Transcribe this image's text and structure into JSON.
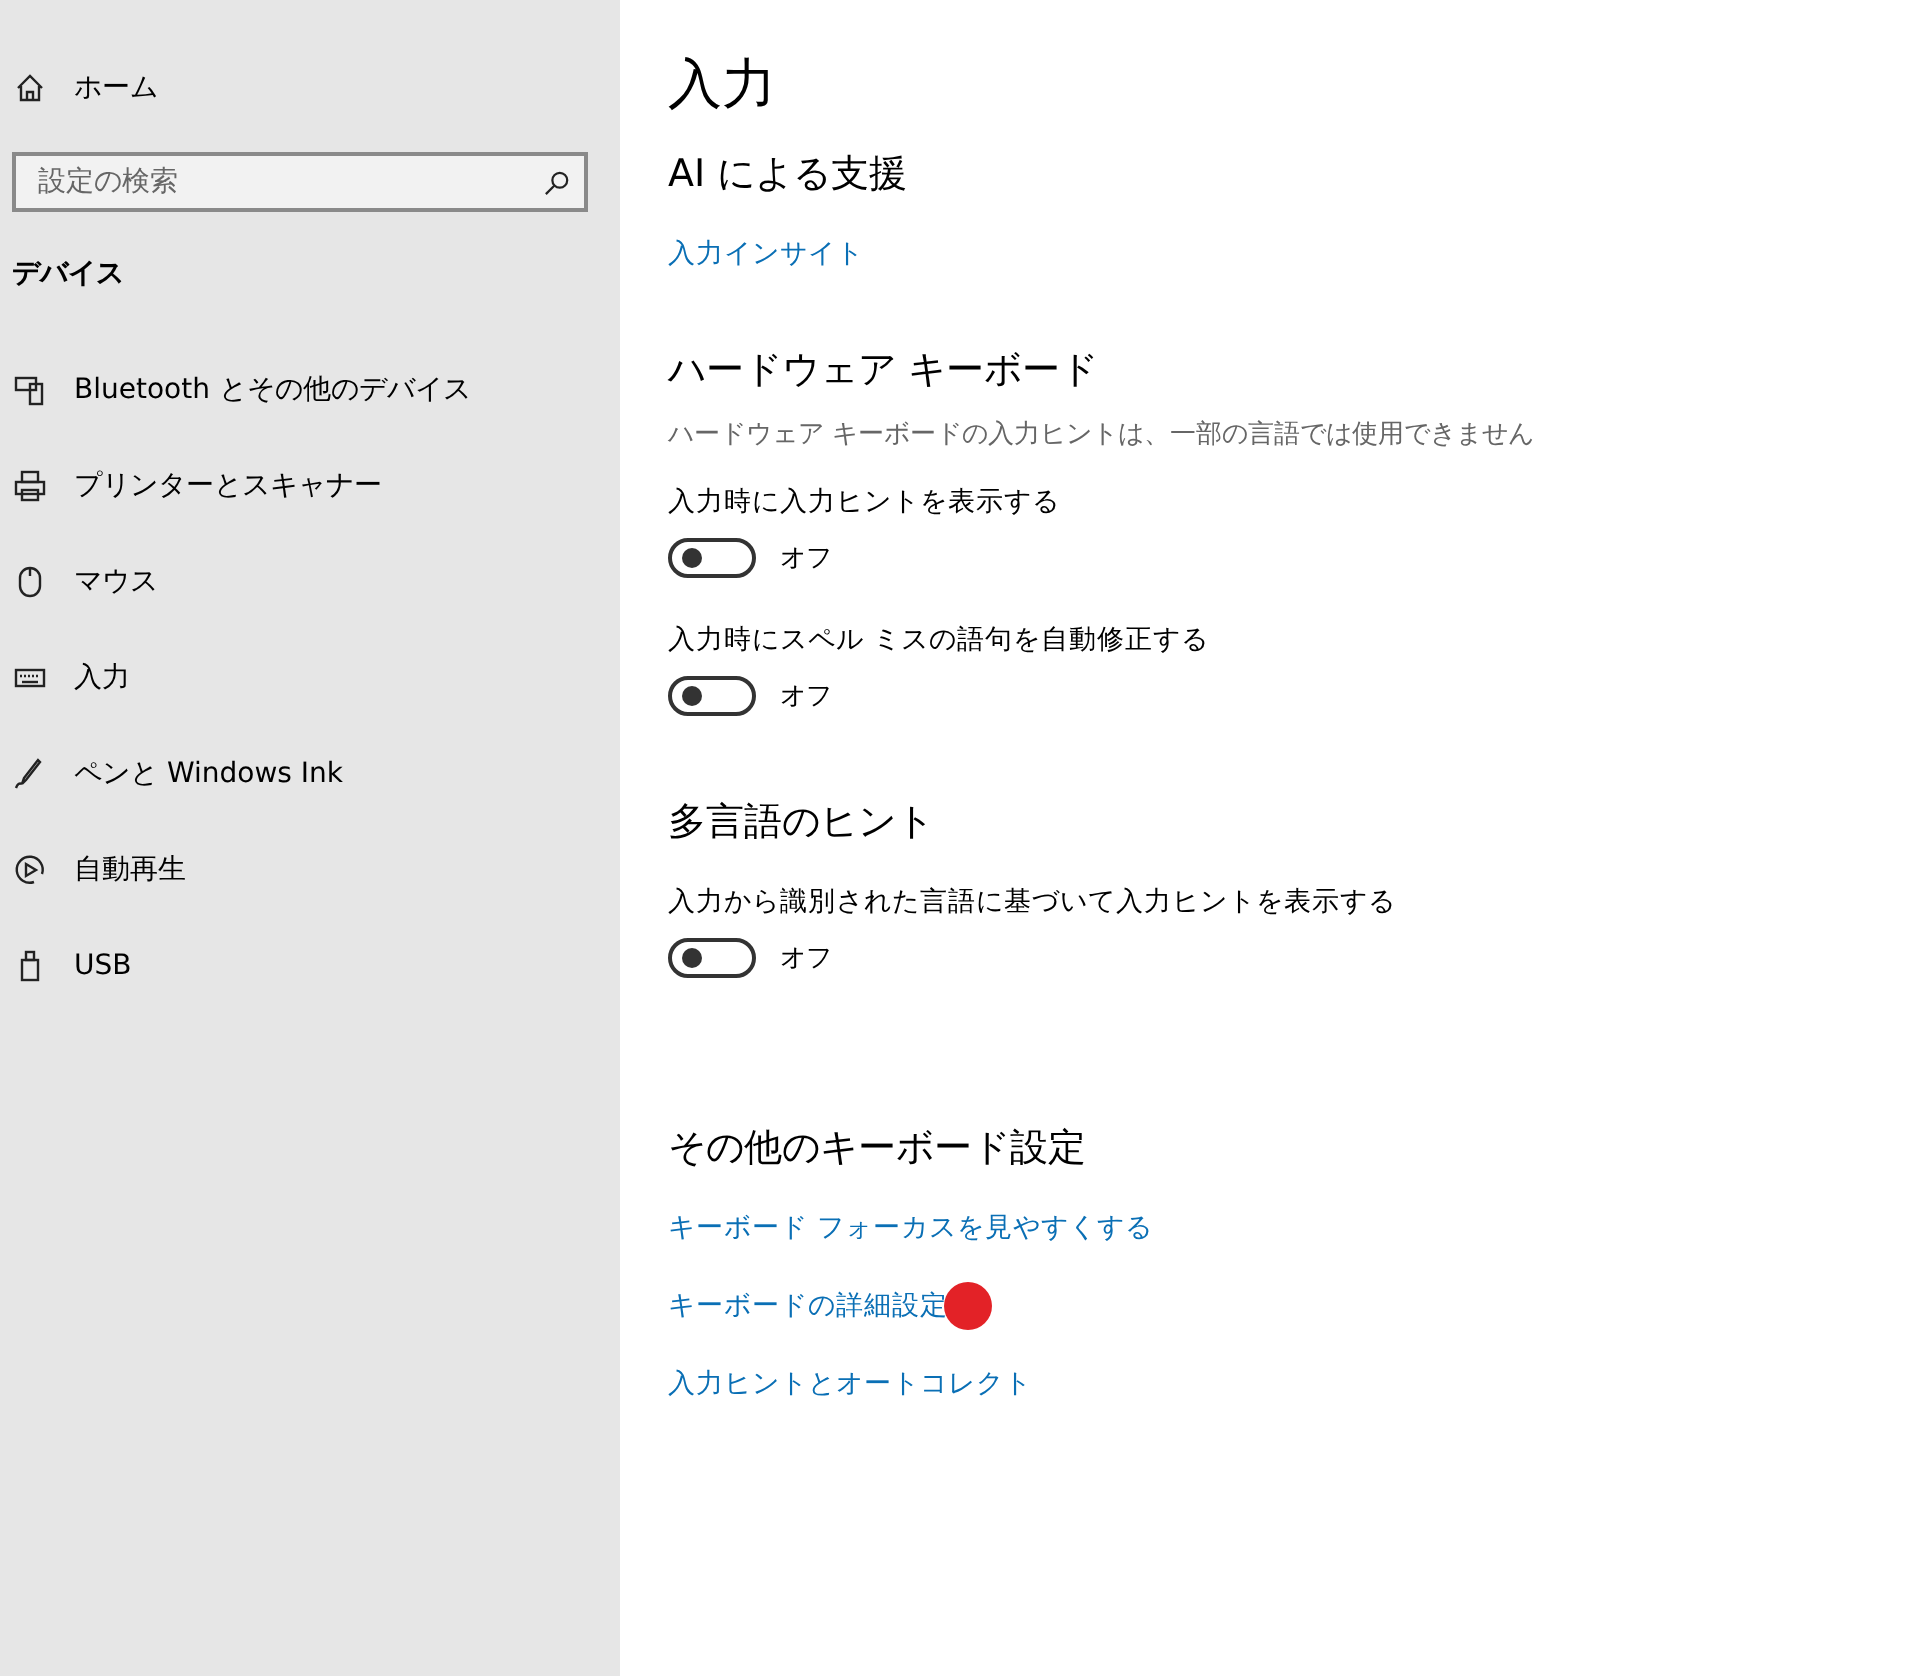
{
  "sidebar": {
    "home": "ホーム",
    "search": {
      "placeholder": "設定の検索"
    },
    "section_title": "デバイス",
    "items": [
      {
        "label": "Bluetooth とその他のデバイス",
        "selected": false
      },
      {
        "label": "プリンターとスキャナー",
        "selected": false
      },
      {
        "label": "マウス",
        "selected": false
      },
      {
        "label": "入力",
        "selected": false
      },
      {
        "label": "ペンと Windows Ink",
        "selected": false
      },
      {
        "label": "自動再生",
        "selected": false
      },
      {
        "label": "USB",
        "selected": false
      }
    ]
  },
  "main": {
    "title": "入力",
    "sections": [
      {
        "heading": "AI による支援",
        "links": [
          {
            "label": "入力インサイト",
            "marked": false
          }
        ]
      },
      {
        "heading": "ハードウェア キーボード",
        "description": "ハードウェア キーボードの入力ヒントは、一部の言語では使用できません",
        "settings": [
          {
            "label": "入力時に入力ヒントを表示する",
            "on": false,
            "state_label": "オフ"
          },
          {
            "label": "入力時にスペル ミスの語句を自動修正する",
            "on": false,
            "state_label": "オフ"
          }
        ]
      },
      {
        "heading": "多言語のヒント",
        "settings": [
          {
            "label": "入力から識別された言語に基づいて入力ヒントを表示する",
            "on": false,
            "state_label": "オフ"
          }
        ]
      },
      {
        "heading": "その他のキーボード設定",
        "links": [
          {
            "label": "キーボード フォーカスを見やすくする",
            "marked": false
          },
          {
            "label": "キーボードの詳細設定",
            "marked": true
          },
          {
            "label": "入力ヒントとオートコレクト",
            "marked": false
          }
        ]
      }
    ]
  }
}
